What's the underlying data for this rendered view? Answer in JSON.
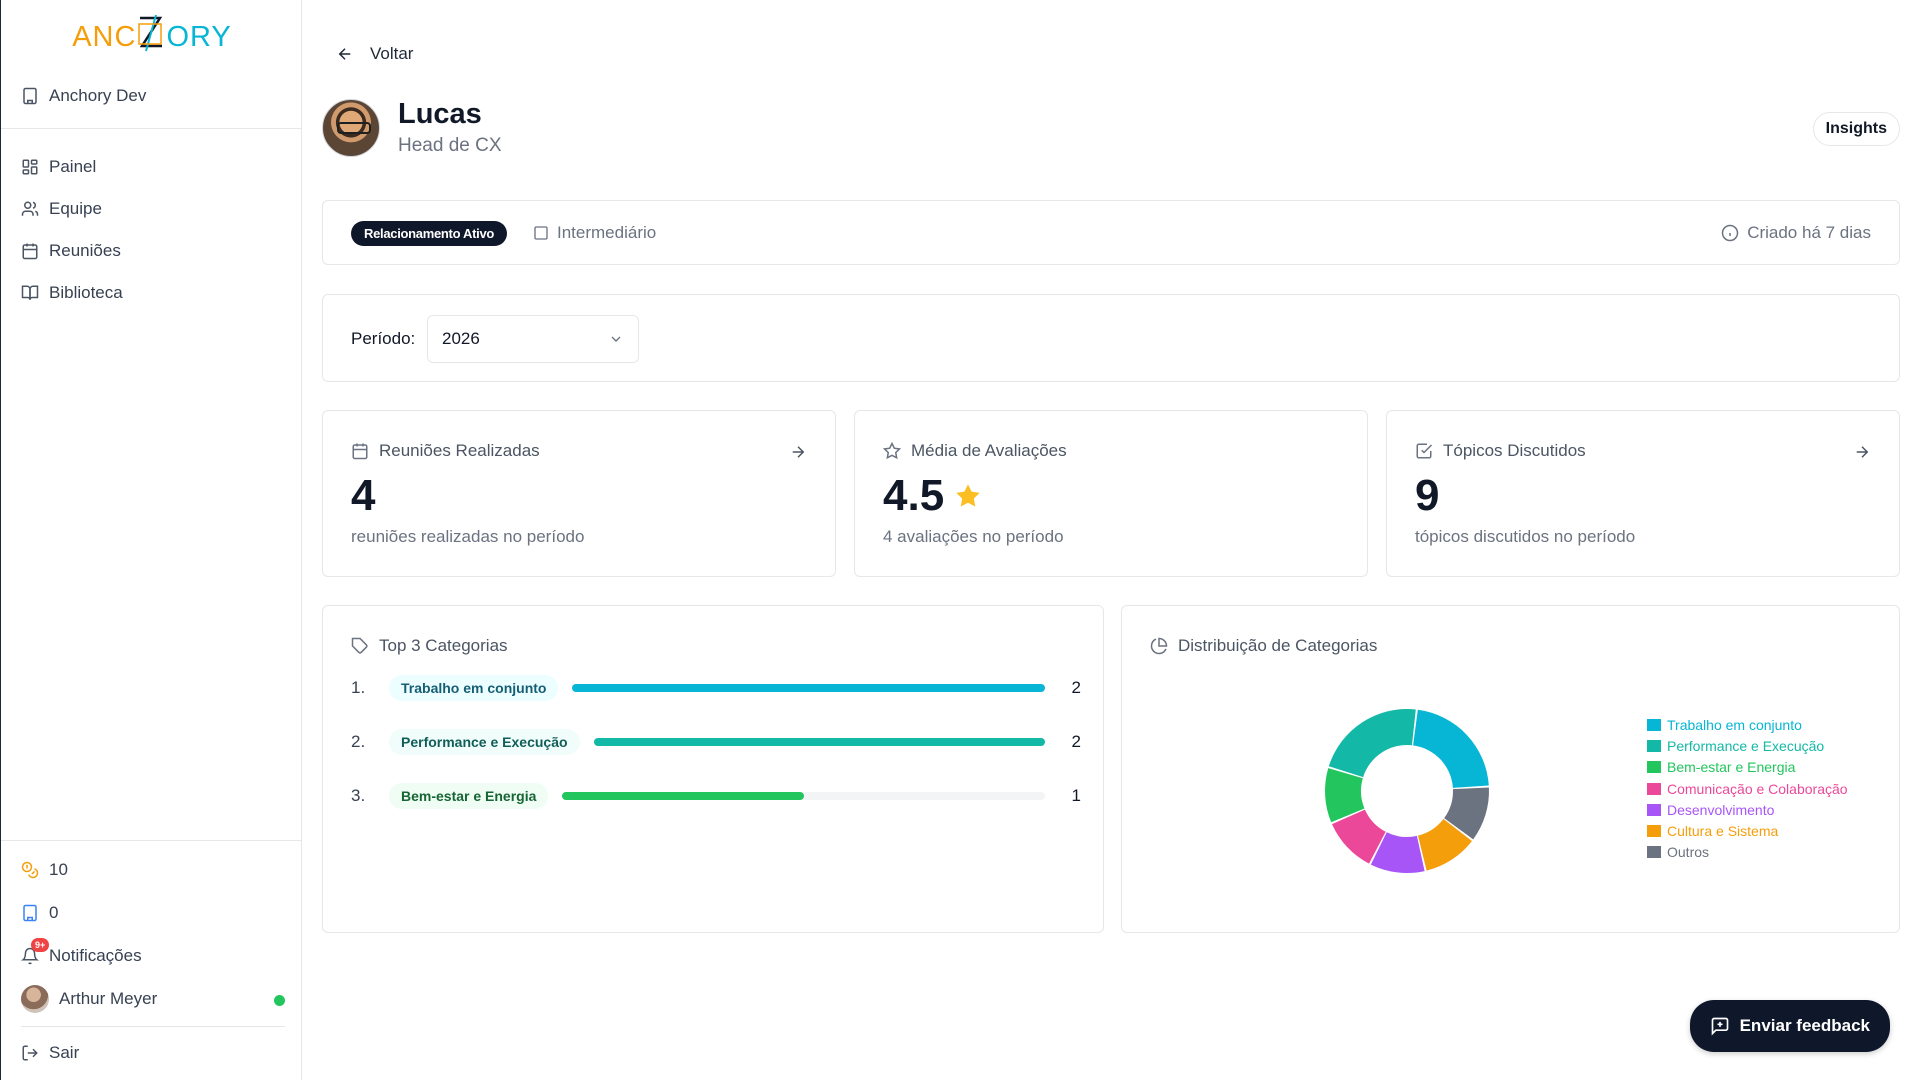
{
  "sidebar": {
    "logo": {
      "left": "ANC",
      "mid": "",
      "right": "ORY",
      "tail": ""
    },
    "org_name": "Anchory Dev",
    "nav": [
      {
        "label": "Painel",
        "icon": "dashboard-icon"
      },
      {
        "label": "Equipe",
        "icon": "users-icon"
      },
      {
        "label": "Reuniões",
        "icon": "calendar-icon"
      },
      {
        "label": "Biblioteca",
        "icon": "book-icon"
      }
    ],
    "coins": "10",
    "credits": "0",
    "notifications": {
      "label": "Notificações",
      "badge": "9+"
    },
    "user": {
      "name": "Arthur Meyer",
      "status_color": "#22c55e"
    },
    "logout": "Sair"
  },
  "header": {
    "back": "Voltar",
    "name": "Lucas",
    "role": "Head de CX",
    "insights": "Insights"
  },
  "status": {
    "pill": "Relacionamento Ativo",
    "level": "Intermediário",
    "created": "Criado há 7 dias"
  },
  "period": {
    "label": "Período:",
    "value": "2026"
  },
  "stats": [
    {
      "title": "Reuniões Realizadas",
      "value": "4",
      "sub": "reuniões realizadas no período"
    },
    {
      "title": "Média de Avaliações",
      "value": "4.5",
      "sub": "4 avaliações no período"
    },
    {
      "title": "Tópicos Discutidos",
      "value": "9",
      "sub": "tópicos discutidos no período"
    }
  ],
  "top_categories": {
    "title": "Top 3 Categorias",
    "items": [
      {
        "rank": "1.",
        "name": "Trabalho em conjunto",
        "count": "2",
        "fraction": 1.0,
        "color": "#06b6d4",
        "bg": "#ecfeff",
        "fg": "#155e75"
      },
      {
        "rank": "2.",
        "name": "Performance e Execução",
        "count": "2",
        "fraction": 1.0,
        "color": "#14b8a6",
        "bg": "#f0fdfa",
        "fg": "#115e59"
      },
      {
        "rank": "3.",
        "name": "Bem-estar e Energia",
        "count": "1",
        "fraction": 0.5,
        "color": "#22c55e",
        "bg": "#f0fdf4",
        "fg": "#166534"
      }
    ]
  },
  "distribution": {
    "title": "Distribuição de Categorias"
  },
  "chart_data": {
    "type": "pie",
    "title": "Distribuição de Categorias",
    "legend_position": "right",
    "categories": [
      "Trabalho em conjunto",
      "Performance e Execução",
      "Bem-estar e Energia",
      "Comunicação e Colaboração",
      "Desenvolvimento",
      "Cultura e Sistema",
      "Outros"
    ],
    "values": [
      2,
      2,
      1,
      1,
      1,
      1,
      1
    ],
    "colors": [
      "#06b6d4",
      "#14b8a6",
      "#22c55e",
      "#ec4899",
      "#a855f7",
      "#f59e0b",
      "#6b7280"
    ],
    "order_clockwise_from_top": [
      "Trabalho em conjunto",
      "Outros",
      "Cultura e Sistema",
      "Desenvolvimento",
      "Comunicação e Colaboração",
      "Bem-estar e Energia",
      "Performance e Execução"
    ]
  },
  "feedback_button": "Enviar feedback",
  "colors": {
    "accent": "#0f172a",
    "star": "#fbbf24"
  }
}
